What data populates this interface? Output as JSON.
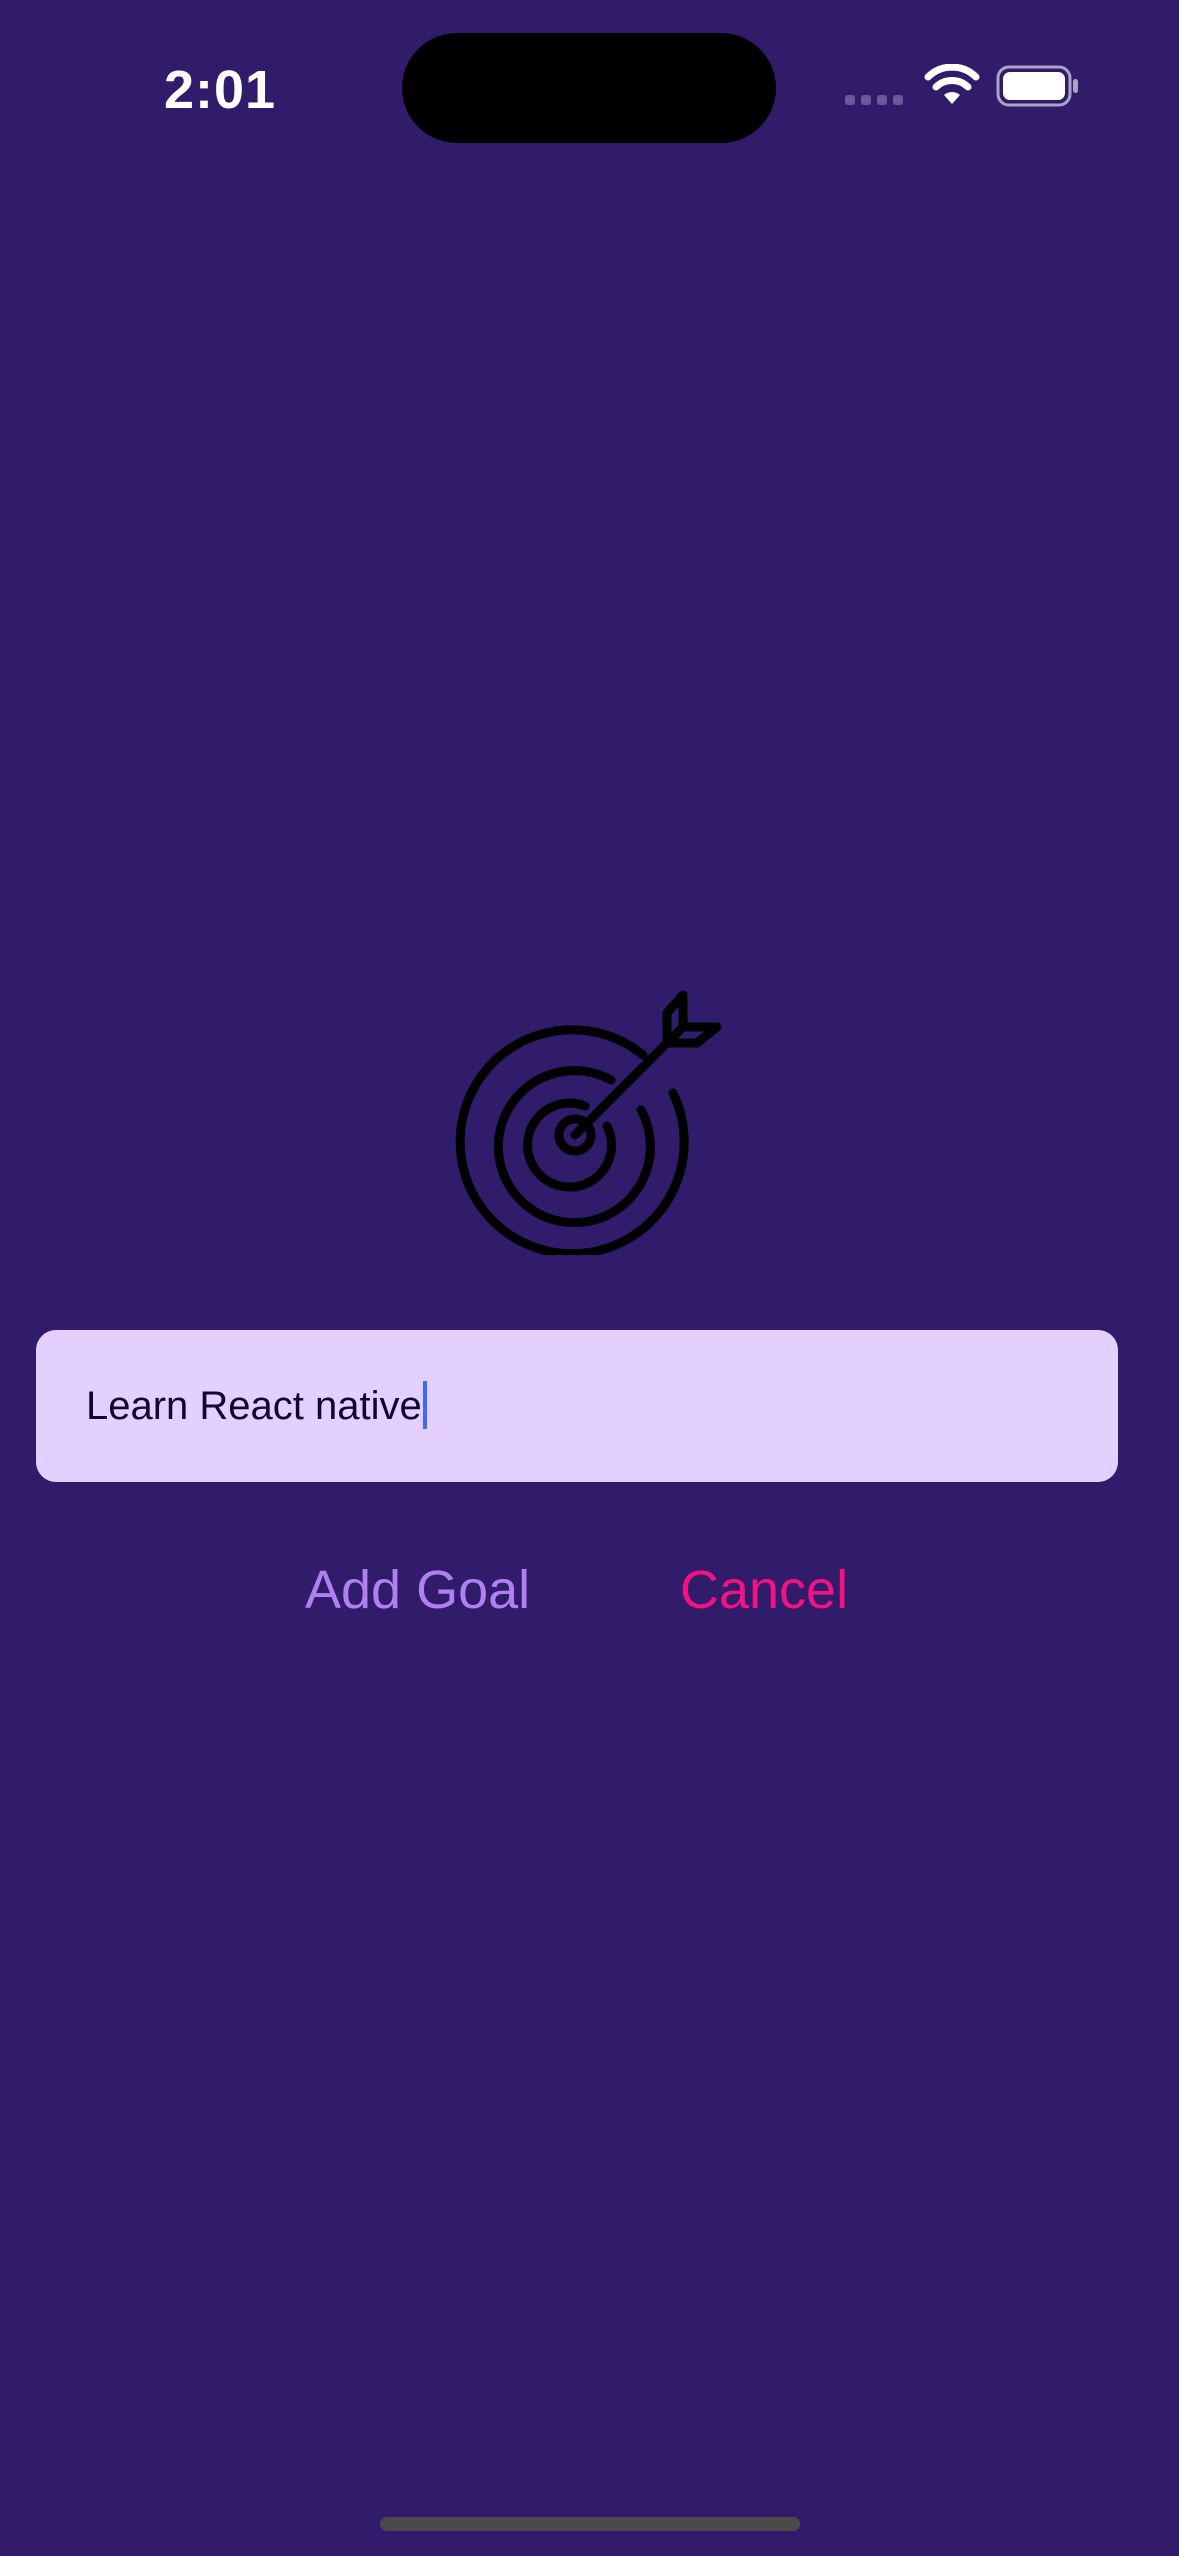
{
  "status_bar": {
    "time": "2:01"
  },
  "goal_input": {
    "value": "Learn React native"
  },
  "buttons": {
    "add_goal": "Add Goal",
    "cancel": "Cancel"
  },
  "icons": {
    "center": "target-icon",
    "status": [
      "cellular-signal-icon",
      "wifi-icon",
      "battery-icon"
    ]
  },
  "colors": {
    "background": "#311b6b",
    "input_background": "#e4d0ff",
    "input_text": "#120438",
    "add_goal": "#b180f0",
    "cancel": "#f31282",
    "caret": "#3a6bff"
  }
}
